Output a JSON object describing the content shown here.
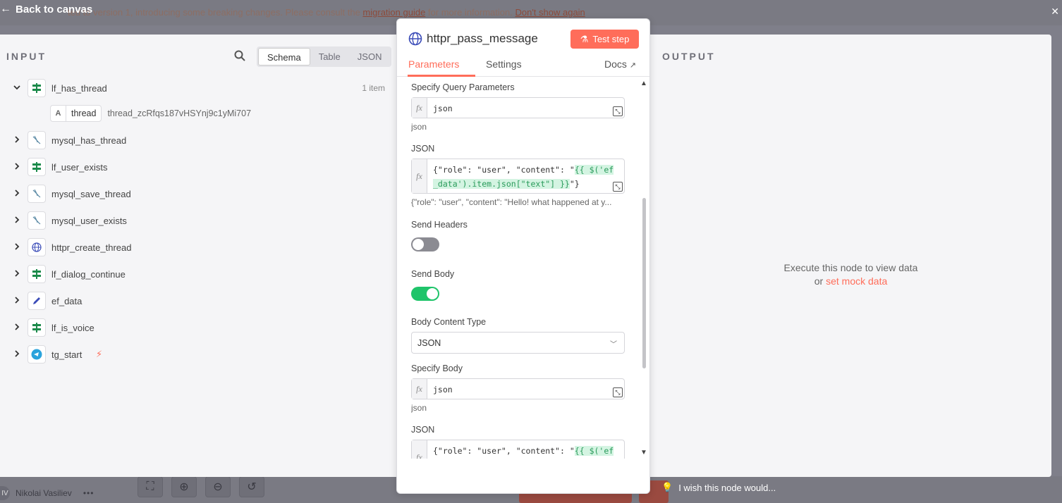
{
  "banner": {
    "back_label": "Back to canvas",
    "notice": "ted to version 1, introducing some breaking changes. Please consult the ",
    "notice_link": "migration guide",
    "notice_mid": " for more information. ",
    "notice_dismiss": "Don't show again"
  },
  "input": {
    "title": "INPUT",
    "view_tabs": [
      "Schema",
      "Table",
      "JSON"
    ],
    "items": [
      {
        "name": "lf_has_thread",
        "icon": "signpost-icon",
        "count": "1 item",
        "expanded": true
      },
      {
        "name": "mysql_has_thread",
        "icon": "mysql-icon"
      },
      {
        "name": "lf_user_exists",
        "icon": "signpost-icon"
      },
      {
        "name": "mysql_save_thread",
        "icon": "mysql-icon"
      },
      {
        "name": "mysql_user_exists",
        "icon": "mysql-icon"
      },
      {
        "name": "httpr_create_thread",
        "icon": "globe-icon"
      },
      {
        "name": "lf_dialog_continue",
        "icon": "signpost-icon"
      },
      {
        "name": "ef_data",
        "icon": "pencil-icon"
      },
      {
        "name": "lf_is_voice",
        "icon": "signpost-icon"
      },
      {
        "name": "tg_start",
        "icon": "telegram-icon"
      }
    ],
    "child": {
      "type": "A",
      "key": "thread",
      "value": "thread_zcRfqs187vHSYnj9c1yMi707"
    }
  },
  "output": {
    "title": "OUTPUT",
    "empty_msg": "Execute this node to view data",
    "or": "or ",
    "mock_link": "set mock data"
  },
  "node": {
    "title": "httpr_pass_message",
    "test_label": "Test step",
    "tabs": {
      "parameters": "Parameters",
      "settings": "Settings",
      "docs": "Docs"
    },
    "params": {
      "query_label": "Specify Query Parameters",
      "query_value": "json",
      "query_hint": "json",
      "json_label": "JSON",
      "json_code_a": "{\"role\": \"user\", \"content\": \"",
      "json_code_hl": "{{ $('ef_data').item.json[\"text\"] }}",
      "json_code_b": "\"}",
      "json_hint": "{\"role\": \"user\", \"content\": \"Hello! what happened at y...",
      "headers_label": "Send Headers",
      "body_label": "Send Body",
      "content_type_label": "Body Content Type",
      "content_type_value": "JSON",
      "body_spec_label": "Specify Body",
      "body_spec_value": "json",
      "body_spec_hint": "json",
      "json2_label": "JSON",
      "json2_code_a": "{\"role\": \"user\", \"content\": \"",
      "json2_code_hl": "{{ $('ef_dat"
    }
  },
  "footer": {
    "user_initials": "IV",
    "user_name": "Nikolai Vasiliev",
    "more": "•••",
    "wish": "I wish this node would..."
  },
  "colors": {
    "accent": "#ff6d5a",
    "toggle_on": "#1fc46a",
    "expr_highlight": "#d4f4e2"
  }
}
